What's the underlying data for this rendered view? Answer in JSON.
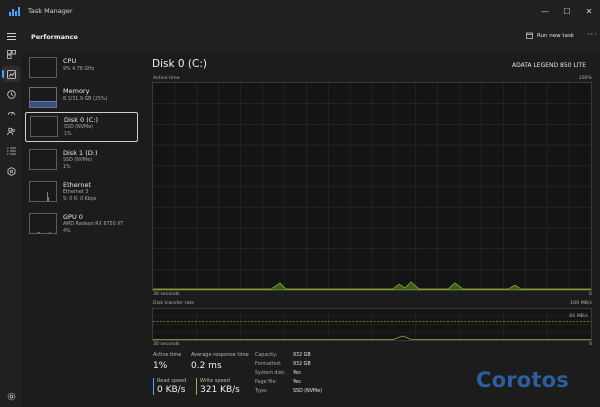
{
  "app": {
    "title": "Task Manager"
  },
  "window_controls": {
    "minimize": "—",
    "maximize": "☐",
    "close": "✕"
  },
  "cmdbar": {
    "section_title": "Performance",
    "run_new_task": "Run new task",
    "more": "···"
  },
  "sidebar": {
    "items": [
      {
        "name": "CPU",
        "sub1": "9% 4.78 GHz",
        "sub2": ""
      },
      {
        "name": "Memory",
        "sub1": "8.1/31.9 GB (25%)",
        "sub2": ""
      },
      {
        "name": "Disk 0 (C:)",
        "sub1": "SSD (NVMe)",
        "sub2": "1%"
      },
      {
        "name": "Disk 1 (D:)",
        "sub1": "SSD (NVMe)",
        "sub2": "1%"
      },
      {
        "name": "Ethernet",
        "sub1": "Ethernet 3",
        "sub2": "S: 0 R: 0 Kbps"
      },
      {
        "name": "GPU 0",
        "sub1": "AMD Radeon RX 6750 XT",
        "sub2": "4%"
      }
    ]
  },
  "main": {
    "title": "Disk 0 (C:)",
    "model": "ADATA LEGEND 850 LITE",
    "active_graph": {
      "label": "Active time",
      "max": "100%",
      "time": "30 seconds",
      "min": "0"
    },
    "transfer_graph": {
      "label": "Disk transfer rate",
      "max": "100 MB/s",
      "mid": "60 MB/s",
      "time": "30 seconds",
      "min": "0"
    },
    "stats": {
      "active_time_label": "Active time",
      "active_time_value": "1%",
      "response_label": "Average response time",
      "response_value": "0.2 ms",
      "read_label": "Read speed",
      "read_value": "0 KB/s",
      "write_label": "Write speed",
      "write_value": "321 KB/s"
    },
    "properties": [
      {
        "key": "Capacity:",
        "value": "932 GB"
      },
      {
        "key": "Formatted:",
        "value": "932 GB"
      },
      {
        "key": "System disk:",
        "value": "Yes"
      },
      {
        "key": "Page file:",
        "value": "Yes"
      },
      {
        "key": "Type:",
        "value": "SSD (NVMe)"
      }
    ]
  },
  "colors": {
    "disk_accent": "#8fb83a",
    "disk_fill": "#3f5a1d",
    "memory_accent": "#5c7ac0",
    "ethernet_accent": "#c77dbb",
    "gpu_accent": "#9b6ec7",
    "rail_accent": "#4aa3ff",
    "read_bar": "#4aa3ff",
    "write_bar": "#8fb83a"
  },
  "watermark": {
    "text": "Corotos"
  }
}
